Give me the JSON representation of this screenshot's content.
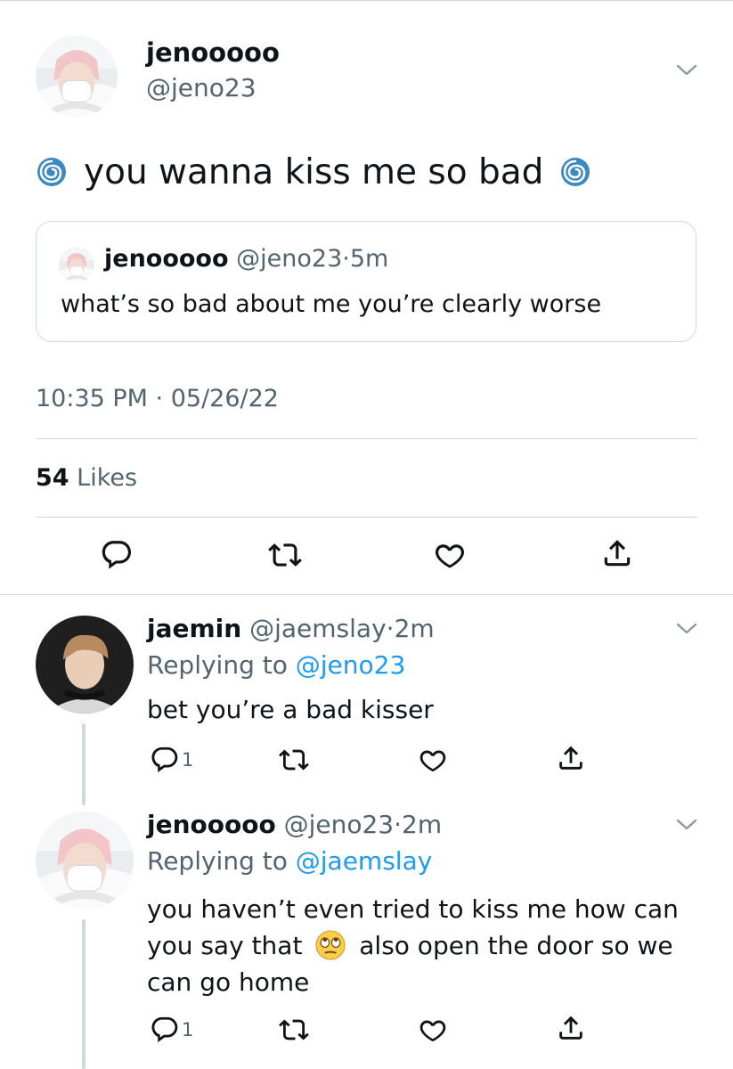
{
  "main_tweet": {
    "display_name": "jenooooo",
    "handle": "@jeno23",
    "text_before": "you wanna kiss me so bad",
    "emoji_name": "cyclone-emoji",
    "quote": {
      "display_name": "jenooooo",
      "handle": "@jeno23",
      "separator": "·",
      "time": "5m",
      "text": "what’s so bad about me you’re clearly worse"
    },
    "timestamp": "10:35 PM · 05/26/22",
    "likes_count": "54",
    "likes_label": "Likes"
  },
  "replies": [
    {
      "display_name": "jaemin",
      "handle": "@jaemslay",
      "separator": "·",
      "time": "2m",
      "replying_prefix": "Replying to",
      "replying_to": "@jeno23",
      "text": "bet you’re a bad kisser",
      "reply_count": "1"
    },
    {
      "display_name": "jenooooo",
      "handle": "@jeno23",
      "separator": "·",
      "time": "2m",
      "replying_prefix": "Replying to",
      "replying_to": "@jaemslay",
      "text_line1": "you haven’t even tried to kiss me how can",
      "text_line2a": "you say that",
      "text_line2b": "also open the door so we",
      "text_line3": "can go home",
      "inline_emoji": "eye-roll-emoji",
      "reply_count": "1"
    }
  ],
  "colors": {
    "text": "#0f1419",
    "secondary": "#536471",
    "link": "#1d9bf0",
    "border": "#cfd9de",
    "cyclone": "#3b88c3"
  }
}
